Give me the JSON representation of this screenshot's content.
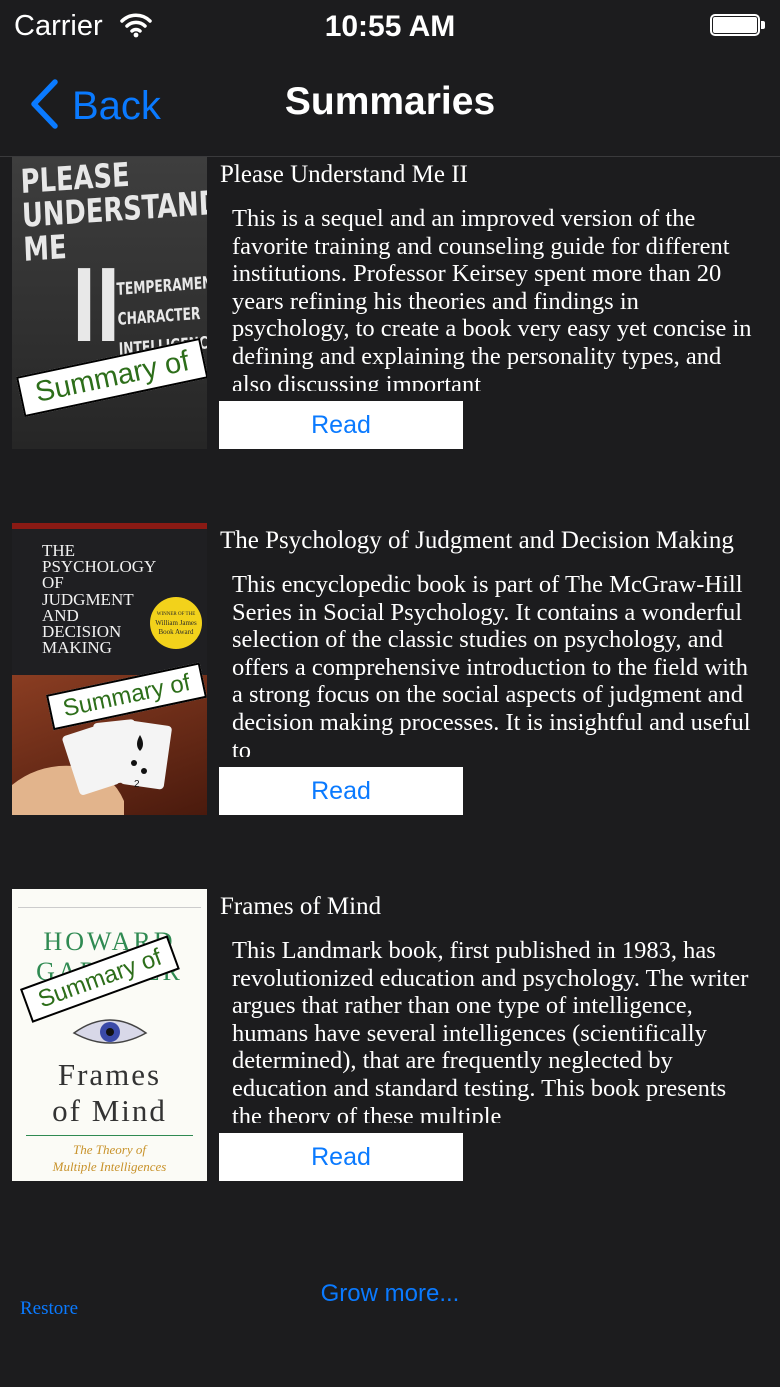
{
  "status_bar": {
    "carrier": "Carrier",
    "time": "10:55 AM"
  },
  "nav": {
    "back_label": "Back",
    "title": "Summaries"
  },
  "colors": {
    "accent": "#0a7aff",
    "background": "#1c1c1e",
    "sticker_text": "#2d6e1a"
  },
  "books": [
    {
      "title": "Please Understand Me II",
      "summary": "This is a sequel and an improved version of the favorite training and counseling guide for different institutions. Professor Keirsey spent more than 20 years refining his theories and findings in psychology, to create a book very easy yet concise in defining and explaining the personality types, and also discussing important",
      "read_label": "Read",
      "sticker": "Summary of",
      "cover": {
        "line1": "PLEASE",
        "line2": "UNDERSTAND",
        "line3": "ME",
        "numeral": "II",
        "sub1": "TEMPERAMENT",
        "sub2": "CHARACTER",
        "sub3": "INTELLIGENCE"
      }
    },
    {
      "title": "The Psychology of Judgment and Decision Making",
      "summary": "This encyclopedic book is part of The McGraw-Hill Series in Social Psychology. It contains a wonderful selection of the classic studies on psychology, and offers a comprehensive introduction to the field with a strong focus on the social aspects of judgment and decision making processes. It is insightful and useful to",
      "read_label": "Read",
      "sticker": "Summary of",
      "cover": {
        "line1": "THE",
        "line2": "PSYCHOLOGY",
        "line3": "OF",
        "line4": "JUDGMENT",
        "line5": "AND",
        "line6": "DECISION",
        "line7": "MAKING",
        "badge1": "WINNER OF THE",
        "badge2": "William James",
        "badge3": "Book Award"
      }
    },
    {
      "title": "Frames of Mind",
      "summary": "This Landmark book, first published in 1983, has revolutionized education and psychology. The writer argues that rather than one type of intelligence, humans have several intelligences (scientifically determined), that are frequently neglected by education and standard testing. This book presents the theory of these multiple",
      "read_label": "Read",
      "sticker": "Summary of",
      "cover": {
        "author1": "HOWARD",
        "author2": "GARDNER",
        "word1": "Frames",
        "word2": "of Mind",
        "sub1": "The Theory of",
        "sub2": "Multiple Intelligences"
      }
    }
  ],
  "footer": {
    "grow_more": "Grow more...",
    "restore": "Restore"
  }
}
